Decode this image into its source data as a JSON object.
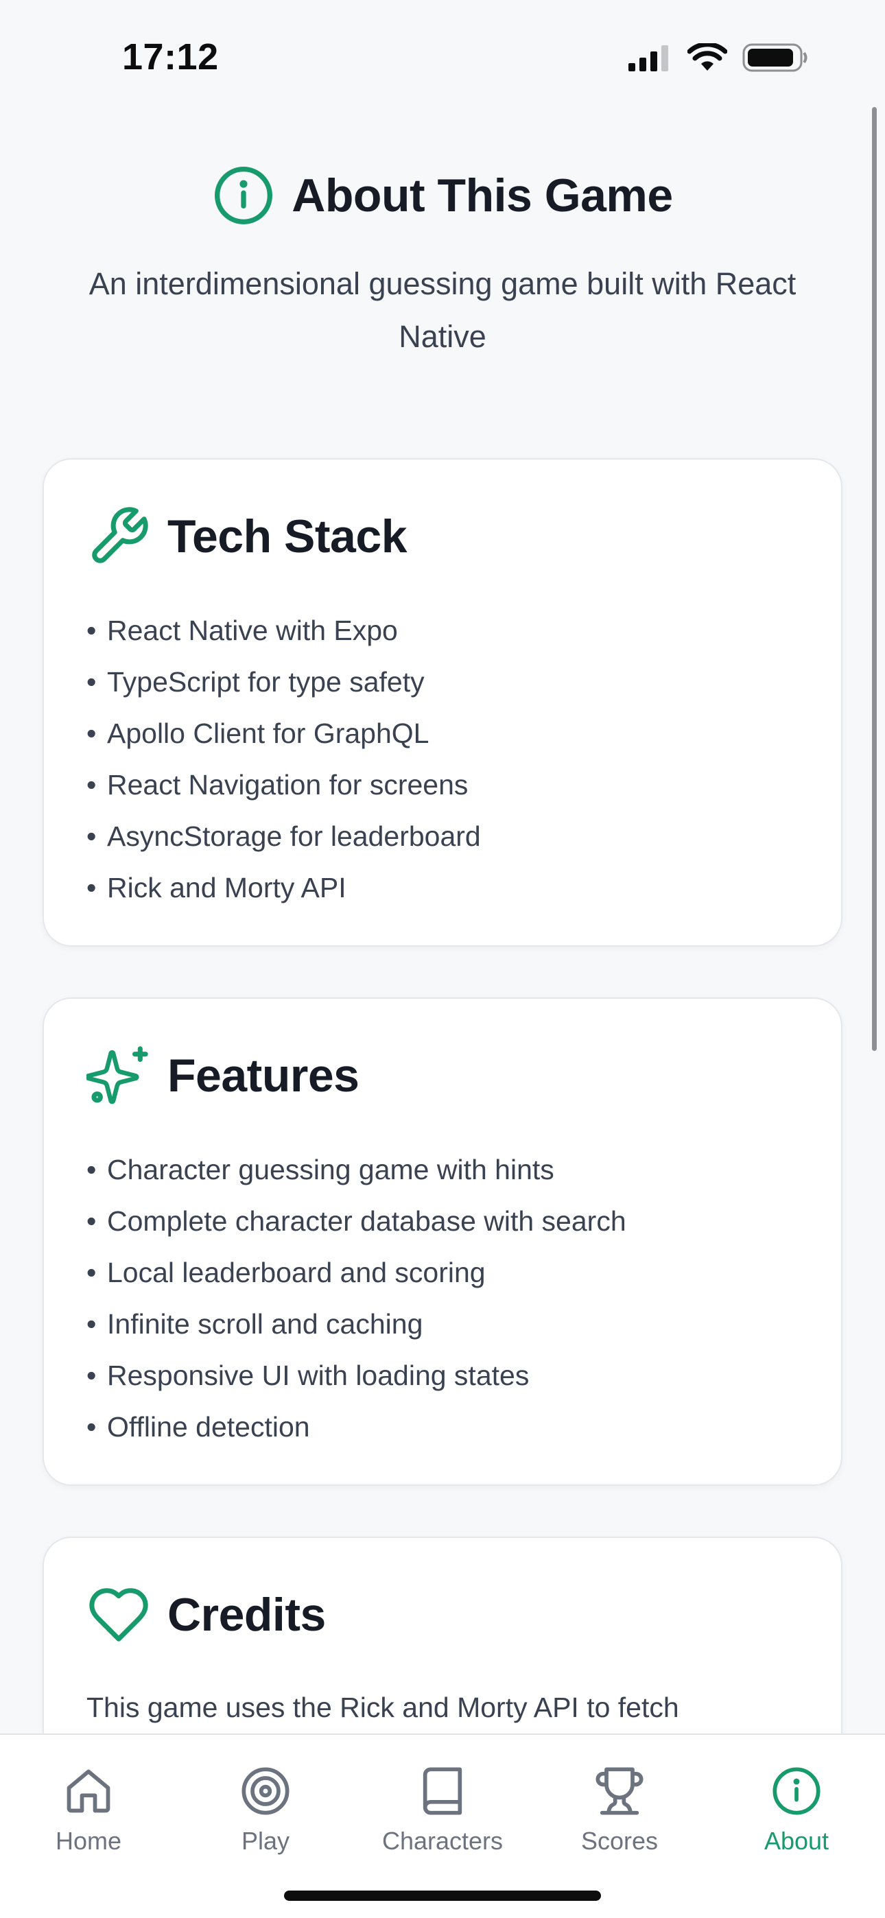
{
  "status_bar": {
    "time": "17:12",
    "icons": [
      "cellular-signal-icon",
      "wifi-icon",
      "battery-icon"
    ]
  },
  "header": {
    "icon": "info-icon",
    "title": "About This Game",
    "subtitle": "An interdimensional guessing game built with React Native"
  },
  "cards": {
    "tech_stack": {
      "icon": "wrench-icon",
      "title": "Tech Stack",
      "items": [
        "React Native with Expo",
        "TypeScript for type safety",
        "Apollo Client for GraphQL",
        "React Navigation for screens",
        "AsyncStorage for leaderboard",
        "Rick and Morty API"
      ]
    },
    "features": {
      "icon": "sparkles-icon",
      "title": "Features",
      "items": [
        "Character guessing game with hints",
        "Complete character database with search",
        "Local leaderboard and scoring",
        "Infinite scroll and caching",
        "Responsive UI with loading states",
        "Offline detection"
      ]
    },
    "credits": {
      "icon": "heart-icon",
      "title": "Credits",
      "text": "This game uses the Rick and Morty API to fetch"
    }
  },
  "tab_bar": {
    "active": "About",
    "tabs": [
      {
        "label": "Home",
        "icon": "home-icon"
      },
      {
        "label": "Play",
        "icon": "target-icon"
      },
      {
        "label": "Characters",
        "icon": "book-icon"
      },
      {
        "label": "Scores",
        "icon": "trophy-icon"
      },
      {
        "label": "About",
        "icon": "info-icon"
      }
    ]
  },
  "colors": {
    "accent": "#179b6c",
    "inactive": "#6c737f",
    "background": "#f7f8fa",
    "card": "#ffffff",
    "heading": "#161b26",
    "body_text": "#3a4150"
  }
}
